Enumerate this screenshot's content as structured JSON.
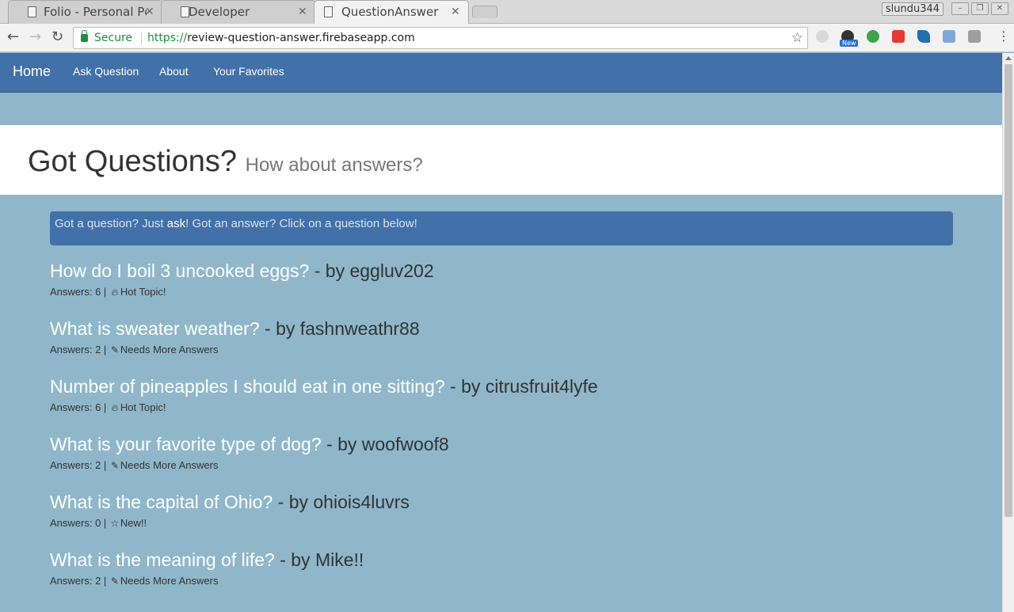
{
  "browser": {
    "tabs": [
      {
        "label": "Folio - Personal Pc",
        "active": false
      },
      {
        "label": "Developer",
        "active": false
      },
      {
        "label": "QuestionAnswer",
        "active": true
      }
    ],
    "user": "slundu344",
    "secure_label": "Secure",
    "url_scheme": "https://",
    "url_host": "review-question-answer.firebaseapp.com",
    "new_badge": "New"
  },
  "navbar": {
    "brand": "Home",
    "links": [
      "Ask Question",
      "About",
      "Your Favorites"
    ]
  },
  "jumbotron": {
    "title": "Got Questions?",
    "subtitle": "How about answers?"
  },
  "info": {
    "before": "Got a question? Just ",
    "link": "ask",
    "after": "! Got an answer? Click on a question below!"
  },
  "questions": [
    {
      "title": "How do I boil 3 uncooked eggs?",
      "by": " - by eggluv202",
      "answers": "Answers: 6 | ",
      "icon": "fire-icon",
      "status": "Hot Topic!"
    },
    {
      "title": "What is sweater weather?",
      "by": " - by fashnweathr88",
      "answers": "Answers: 2 | ",
      "icon": "pencil-icon",
      "status": "Needs More Answers"
    },
    {
      "title": "Number of pineapples I should eat in one sitting?",
      "by": " - by citrusfruit4lyfe",
      "answers": "Answers: 6 | ",
      "icon": "fire-icon",
      "status": "Hot Topic!"
    },
    {
      "title": "What is your favorite type of dog?",
      "by": " - by woofwoof8",
      "answers": "Answers: 2 | ",
      "icon": "pencil-icon",
      "status": "Needs More Answers"
    },
    {
      "title": "What is the capital of Ohio?",
      "by": " - by ohiois4luvrs",
      "answers": "Answers: 0 | ",
      "icon": "star-icon",
      "status": "New!!"
    },
    {
      "title": "What is the meaning of life?",
      "by": " - by Mike!!",
      "answers": "Answers: 2 | ",
      "icon": "pencil-icon",
      "status": "Needs More Answers"
    }
  ]
}
